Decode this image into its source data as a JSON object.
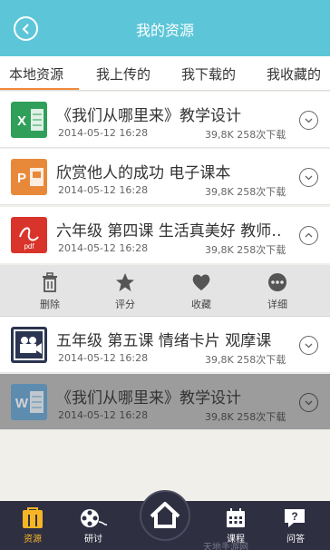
{
  "header": {
    "title": "我的资源"
  },
  "tabs": [
    {
      "label": "本地资源",
      "active": true
    },
    {
      "label": "我上传的",
      "active": false
    },
    {
      "label": "我下载的",
      "active": false
    },
    {
      "label": "我收藏的",
      "active": false
    }
  ],
  "files": [
    {
      "name": "《我们从哪里来》教学设计",
      "date": "2014-05-12  16:28",
      "size_downloads": "39,8K  258次下载",
      "icon": "excel-file-icon",
      "icon_color": "#2f9f5a",
      "icon_letter": "X",
      "expanded": false
    },
    {
      "name": "欣赏他人的成功 电子课本",
      "date": "2014-05-12  16:28",
      "size_downloads": "39,8K  258次下载",
      "icon": "powerpoint-file-icon",
      "icon_color": "#e8893a",
      "icon_letter": "P",
      "expanded": false
    },
    {
      "name": "六年级 第四课 生活真美好 教师…",
      "date": "2014-05-12  16:28",
      "size_downloads": "39,8K  258次下载",
      "icon": "pdf-file-icon",
      "icon_color": "#d9342b",
      "icon_letter": "pdf",
      "expanded": true
    },
    {
      "name": "五年级 第五课 情绪卡片 观摩课",
      "date": "2014-05-12  16:28",
      "size_downloads": "39,8K  258次下载",
      "icon": "video-file-icon",
      "icon_color": "#2b3450",
      "icon_letter": "",
      "expanded": false
    },
    {
      "name": "《我们从哪里来》教学设计",
      "date": "2014-05-12  16:28",
      "size_downloads": "39,8K  258次下载",
      "icon": "word-file-icon",
      "icon_color": "#2a7fc0",
      "icon_letter": "W",
      "expanded": false
    }
  ],
  "actions": [
    {
      "label": "删除",
      "icon": "trash-icon"
    },
    {
      "label": "评分",
      "icon": "star-icon"
    },
    {
      "label": "收藏",
      "icon": "heart-icon"
    },
    {
      "label": "详细",
      "icon": "more-icon"
    }
  ],
  "bottom_nav": [
    {
      "label": "资源",
      "icon": "resources-icon",
      "active": true
    },
    {
      "label": "研讨",
      "icon": "film-reel-icon",
      "active": false
    },
    {
      "label": "课程",
      "icon": "calendar-icon",
      "active": false
    },
    {
      "label": "问答",
      "icon": "question-chat-icon",
      "active": false
    }
  ],
  "home": {
    "icon": "home-icon"
  },
  "watermark": "天地手游网",
  "colors": {
    "header": "#5cc6d8",
    "tab_underline": "#f08a3a",
    "nav_background": "#2f2f42",
    "nav_active": "#f5b525"
  }
}
